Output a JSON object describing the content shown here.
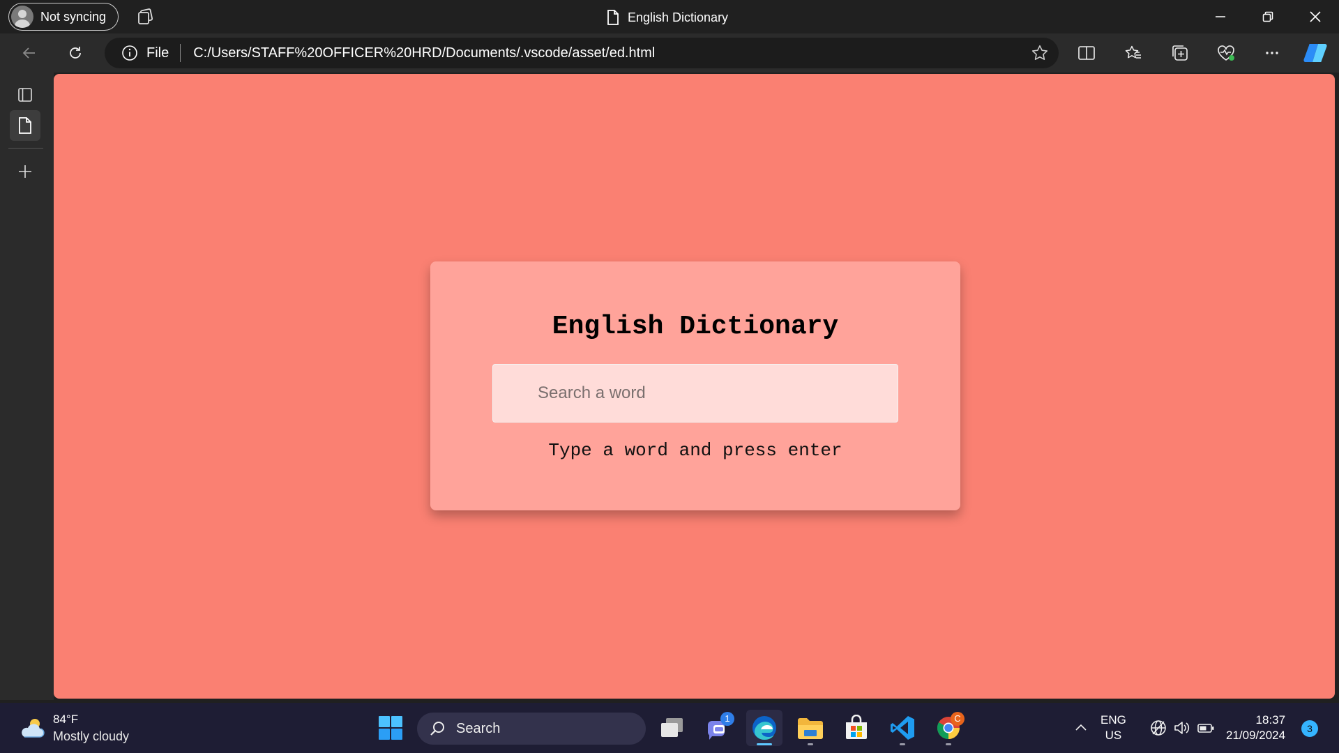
{
  "browser": {
    "profile_label": "Not syncing",
    "tab_title": "English Dictionary",
    "address": {
      "scheme_label": "File",
      "url": "C:/Users/STAFF%20OFFICER%20HRD/Documents/.vscode/asset/ed.html"
    },
    "toolbar_icons": [
      "back-icon",
      "refresh-icon",
      "info-icon",
      "favorite-star-icon",
      "split-screen-icon",
      "favorites-icon",
      "collections-icon",
      "browser-essentials-icon",
      "more-icon",
      "copilot-icon"
    ],
    "window_controls": [
      "minimize-icon",
      "restore-icon",
      "close-icon"
    ]
  },
  "sidebar": {
    "items": [
      "tab-actions-icon",
      "page-tab-icon",
      "new-tab-icon"
    ]
  },
  "page": {
    "title": "English Dictionary",
    "search_placeholder": "Search a word",
    "hint": "Type a word and press enter",
    "colors": {
      "background": "#fa8072",
      "card": "#ffa39a",
      "input": "#ffdcd9"
    }
  },
  "taskbar": {
    "weather": {
      "temp": "84°F",
      "description": "Mostly cloudy"
    },
    "search_label": "Search",
    "apps": [
      {
        "name": "task-view",
        "badge": ""
      },
      {
        "name": "teams-chat",
        "badge": "1"
      },
      {
        "name": "microsoft-edge",
        "badge": ""
      },
      {
        "name": "file-explorer",
        "badge": ""
      },
      {
        "name": "microsoft-store",
        "badge": ""
      },
      {
        "name": "visual-studio-code",
        "badge": ""
      },
      {
        "name": "google-chrome",
        "badge": "C"
      }
    ],
    "language": {
      "line1": "ENG",
      "line2": "US"
    },
    "clock": {
      "time": "18:37",
      "date": "21/09/2024"
    },
    "notification_count": "3"
  }
}
